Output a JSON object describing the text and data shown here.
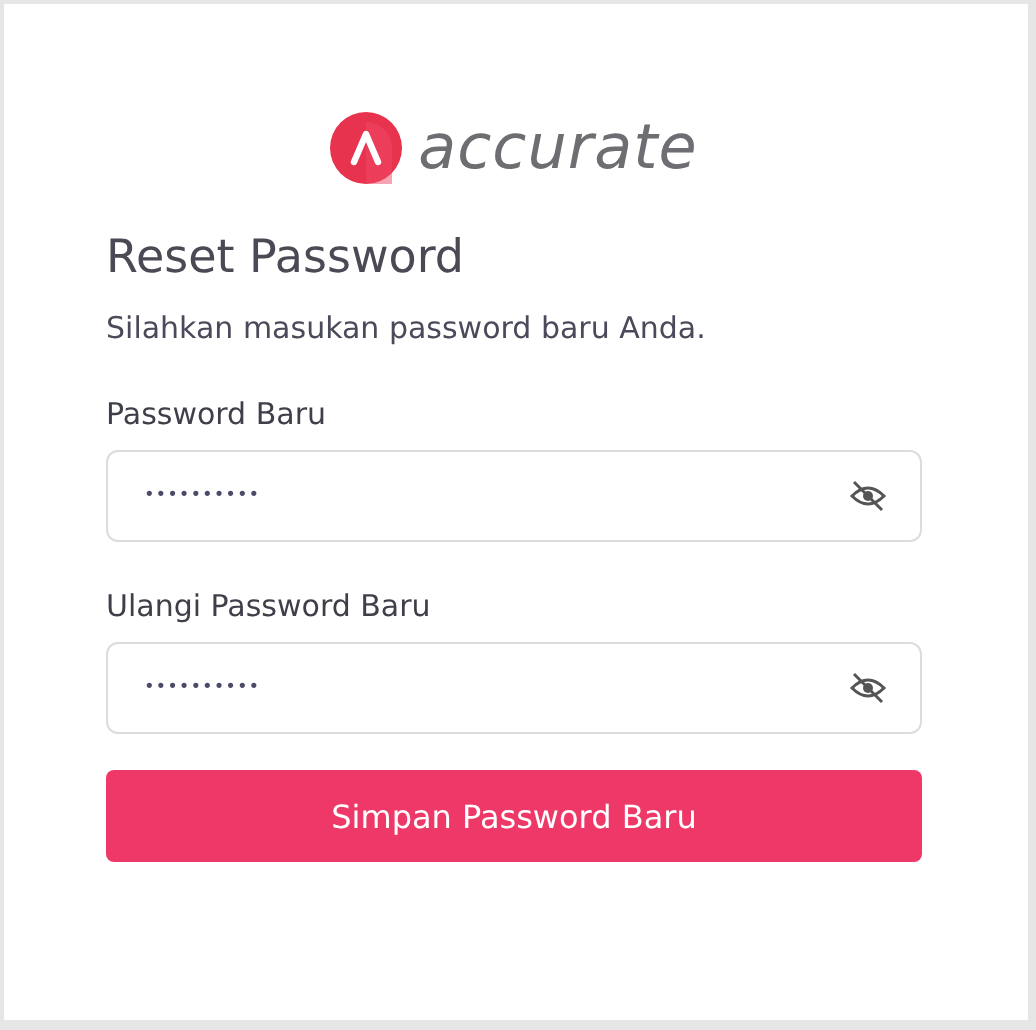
{
  "logo": {
    "wordmark": "accurate"
  },
  "title": "Reset Password",
  "subtitle": "Silahkan masukan password baru Anda.",
  "fields": [
    {
      "label": "Password Baru",
      "value": "••••••••••",
      "password_visible": false
    },
    {
      "label": "Ulangi Password Baru",
      "value": "••••••••••",
      "password_visible": false
    }
  ],
  "submit_button": "Simpan Password Baru"
}
